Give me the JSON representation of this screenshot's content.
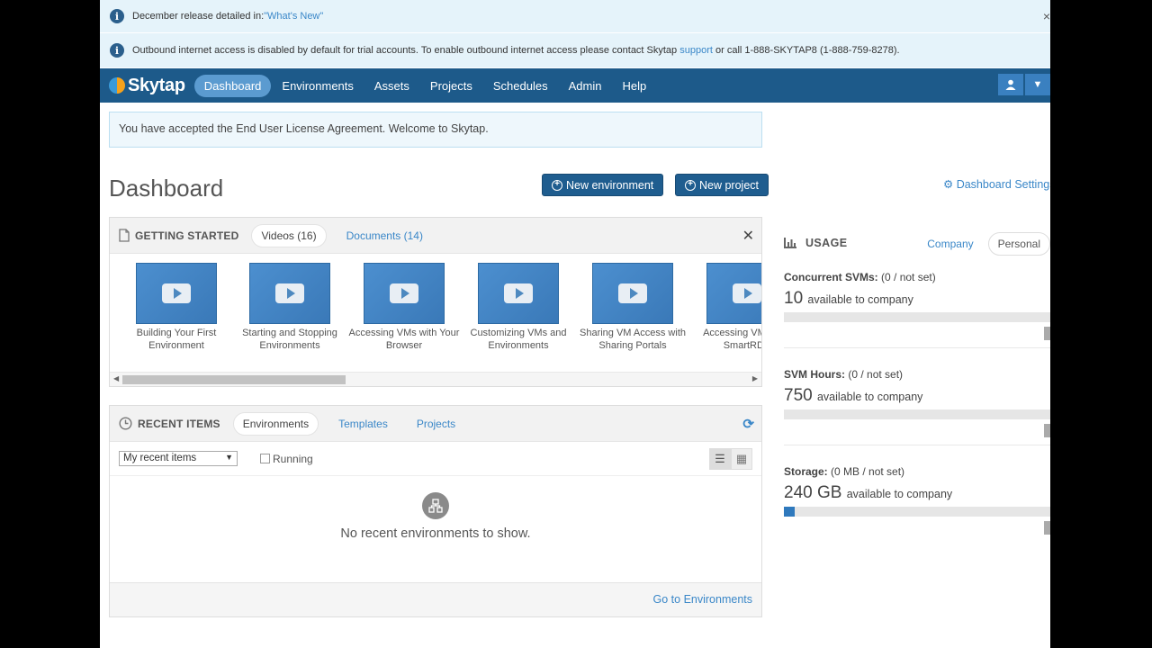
{
  "notices": {
    "release_text": "December release detailed in: ",
    "release_link": "\"What's New\"",
    "outbound_text": "Outbound internet access is disabled by default for trial accounts. To enable outbound internet access please contact Skytap ",
    "outbound_link": "support",
    "outbound_text2": " or call 1-888-SKYTAP8 (1-888-759-8278).",
    "close": "×"
  },
  "nav": {
    "logo": "Skytap",
    "items": [
      "Dashboard",
      "Environments",
      "Assets",
      "Projects",
      "Schedules",
      "Admin",
      "Help"
    ],
    "active": "Dashboard"
  },
  "alert": "You have accepted the End User License Agreement. Welcome to Skytap.",
  "page_title": "Dashboard",
  "buttons": {
    "new_environment": "New environment",
    "new_project": "New project"
  },
  "dashboard_settings": "Dashboard Settings",
  "getting_started": {
    "title": "GETTING STARTED",
    "tabs": [
      "Videos (16)",
      "Documents (14)"
    ],
    "videos": [
      "Building Your First Environment",
      "Starting and Stopping Environments",
      "Accessing VMs with Your Browser",
      "Customizing VMs and Environments",
      "Sharing VM Access with Sharing Portals",
      "Accessing VMs with SmartRDP"
    ],
    "close": "✕"
  },
  "recent": {
    "title": "RECENT ITEMS",
    "tabs": [
      "Environments",
      "Templates",
      "Projects"
    ],
    "select_value": "My recent items",
    "running_label": "Running",
    "empty_msg": "No recent environments to show.",
    "footer_link": "Go to Environments"
  },
  "usage": {
    "title": "USAGE",
    "tabs": [
      "Company",
      "Personal"
    ],
    "metrics": [
      {
        "label": "Concurrent SVMs:",
        "detail": "(0 / not set)",
        "value": "10",
        "unit_text": "available to company",
        "fill_fraction": 0
      },
      {
        "label": "SVM Hours:",
        "detail": "(0 / not set)",
        "value": "750",
        "unit_text": "available to company",
        "fill_fraction": 0
      },
      {
        "label": "Storage:",
        "detail": "(0 MB / not set)",
        "value": "240 GB",
        "unit_text": "available to company",
        "fill_fraction": 0.04
      }
    ]
  },
  "colors": {
    "navbar": "#1d5a8a",
    "accent": "#3a87c8",
    "button": "#1f5d8f",
    "notice_bg": "#e5f3fa"
  }
}
